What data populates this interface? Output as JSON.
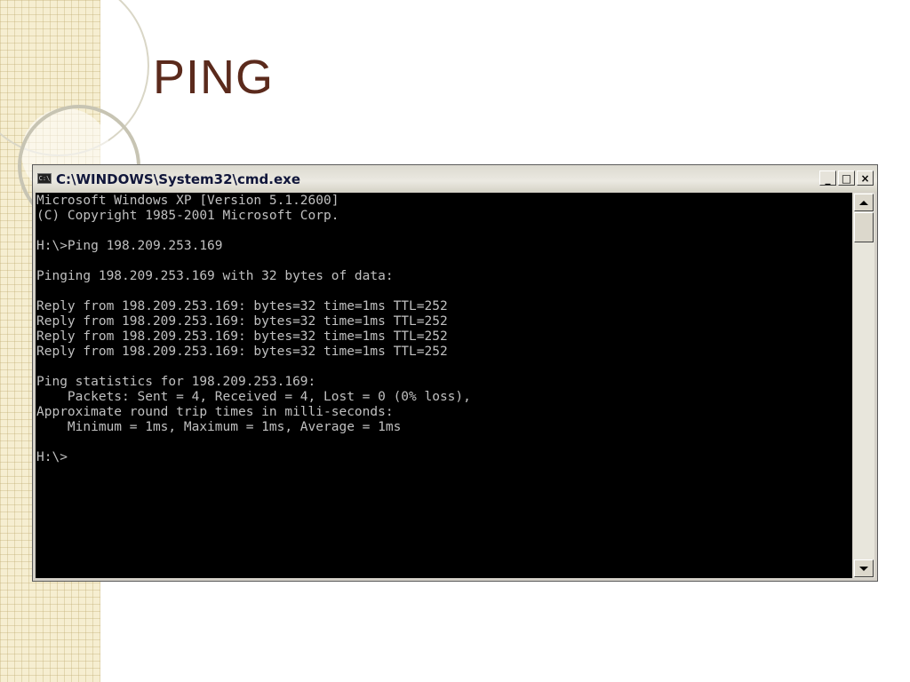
{
  "slide": {
    "title": "PING"
  },
  "window": {
    "title": "C:\\WINDOWS\\System32\\cmd.exe",
    "icon": "cmd-icon",
    "icon_label": "C:\\",
    "minimize_label": "_",
    "maximize_label": "□",
    "close_label": "×"
  },
  "console": {
    "lines": [
      "Microsoft Windows XP [Version 5.1.2600]",
      "(C) Copyright 1985-2001 Microsoft Corp.",
      "",
      "H:\\>Ping 198.209.253.169",
      "",
      "Pinging 198.209.253.169 with 32 bytes of data:",
      "",
      "Reply from 198.209.253.169: bytes=32 time=1ms TTL=252",
      "Reply from 198.209.253.169: bytes=32 time=1ms TTL=252",
      "Reply from 198.209.253.169: bytes=32 time=1ms TTL=252",
      "Reply from 198.209.253.169: bytes=32 time=1ms TTL=252",
      "",
      "Ping statistics for 198.209.253.169:",
      "    Packets: Sent = 4, Received = 4, Lost = 0 (0% loss),",
      "Approximate round trip times in milli-seconds:",
      "    Minimum = 1ms, Maximum = 1ms, Average = 1ms",
      "",
      "H:\\>"
    ]
  },
  "colors": {
    "title": "#5b2a1c",
    "console_bg": "#000000",
    "console_text": "#c0c0c0"
  }
}
